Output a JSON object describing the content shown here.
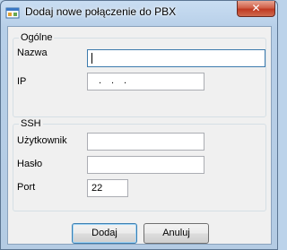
{
  "window": {
    "title": "Dodaj nowe połączenie do PBX",
    "close_label": "✕"
  },
  "general": {
    "title": "Ogólne",
    "name_label": "Nazwa",
    "name_value": "",
    "ip_label": "IP",
    "ip_value": ".  .  ."
  },
  "ssh": {
    "title": "SSH",
    "user_label": "Użytkownik",
    "user_value": "",
    "password_label": "Hasło",
    "password_value": "",
    "port_label": "Port",
    "port_value": "22"
  },
  "buttons": {
    "add_label": "Dodaj",
    "cancel_label": "Anuluj"
  }
}
